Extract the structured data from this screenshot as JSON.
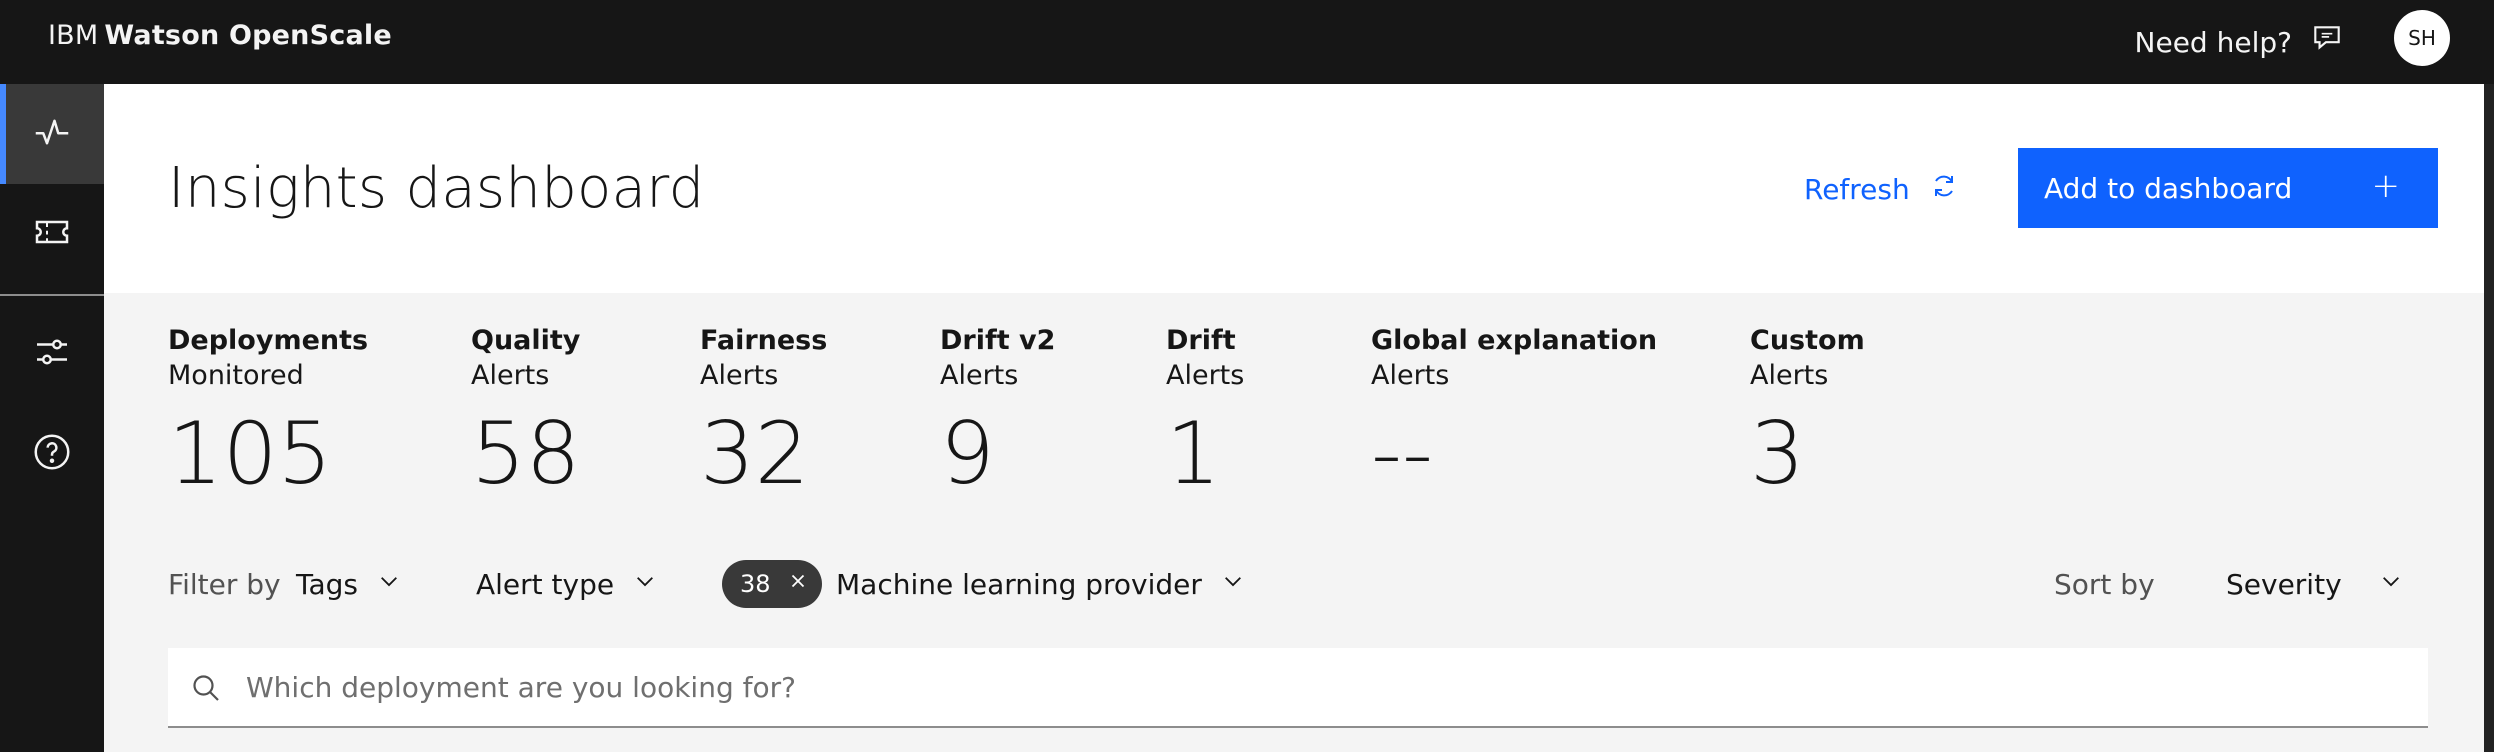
{
  "header": {
    "brand_prefix": "IBM",
    "brand_name": "Watson OpenScale",
    "help_label": "Need help?",
    "avatar_initials": "SH"
  },
  "sidenav": {
    "items": [
      {
        "icon": "activity-icon",
        "active": true
      },
      {
        "icon": "ticket-icon",
        "active": false
      },
      {
        "icon": "settings-adjust-icon",
        "active": false
      },
      {
        "icon": "help-icon",
        "active": false
      }
    ]
  },
  "page": {
    "title": "Insights dashboard",
    "refresh_label": "Refresh",
    "add_label": "Add to dashboard",
    "add_icon": "+"
  },
  "stats": [
    {
      "label": "Deployments",
      "sub": "Monitored",
      "value": "105"
    },
    {
      "label": "Quality",
      "sub": "Alerts",
      "value": "58"
    },
    {
      "label": "Fairness",
      "sub": "Alerts",
      "value": "32"
    },
    {
      "label": "Drift v2",
      "sub": "Alerts",
      "value": "9"
    },
    {
      "label": "Drift",
      "sub": "Alerts",
      "value": "1"
    },
    {
      "label": "Global explanation",
      "sub": "Alerts",
      "value": "--"
    },
    {
      "label": "Custom",
      "sub": "Alerts",
      "value": "3"
    }
  ],
  "filters": {
    "filter_by_label": "Filter by",
    "tags_label": "Tags",
    "alert_type_label": "Alert type",
    "ml_provider_count": "38",
    "ml_provider_label": "Machine learning provider",
    "sort_by_label": "Sort by",
    "sort_value": "Severity"
  },
  "search": {
    "placeholder": "Which deployment are you looking for?",
    "value": ""
  },
  "colors": {
    "primary": "#0f62fe",
    "header_bg": "#161616",
    "content_bg": "#f4f4f4",
    "active_indicator": "#4589ff"
  }
}
